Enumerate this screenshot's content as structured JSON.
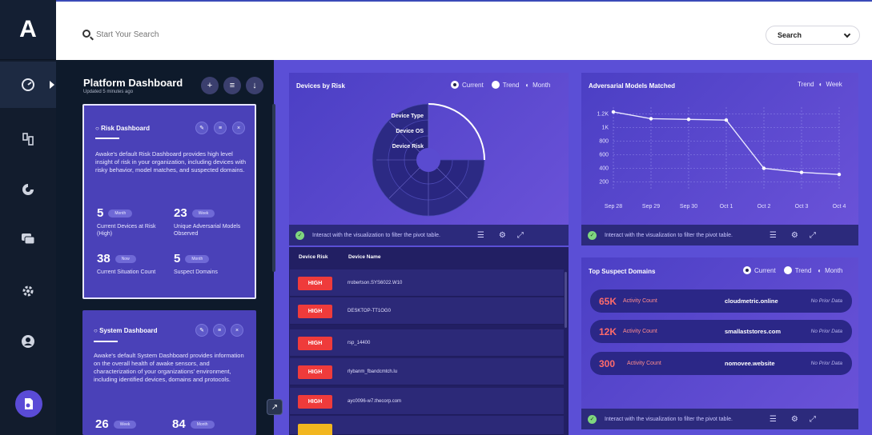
{
  "app": {
    "logo": "A"
  },
  "topbar": {
    "search_placeholder": "Start Your Search",
    "search_scope": "Search"
  },
  "rail": {
    "icons": [
      "dashboard-icon",
      "devices-icon",
      "models-icon",
      "chat-icon",
      "settings-icon",
      "user-icon",
      "report-icon"
    ]
  },
  "sidebar": {
    "title": "Platform Dashboard",
    "subtitle": "Updated 5 minutes ago",
    "cards": [
      {
        "title": "Risk Dashboard",
        "description": "Awake's default Risk Dashboard provides high level insight of risk in your organization, including devices with risky behavior, model matches, and suspected domains.",
        "stats": [
          {
            "value": "5",
            "period": "Month",
            "label": "Current Devices at Risk (High)"
          },
          {
            "value": "23",
            "period": "Week",
            "label": "Unique Adversarial Models Observed"
          },
          {
            "value": "38",
            "period": "Now",
            "label": "Current Situation Count"
          },
          {
            "value": "5",
            "period": "Month",
            "label": "Suspect Domains"
          }
        ]
      },
      {
        "title": "System Dashboard",
        "description": "Awake's default System Dashboard provides information on the overall health of awake sensors, and characterization of your organizations' environment, including identified devices, domains and protocols.",
        "stats": [
          {
            "value": "26",
            "period": "Week"
          },
          {
            "value": "84",
            "period": "Month"
          }
        ]
      }
    ]
  },
  "devices_by_risk": {
    "title": "Devices by Risk",
    "toggle_current": "Current",
    "toggle_trend": "Trend",
    "toggle_period": "Month",
    "rings": [
      "Device Type",
      "Device OS",
      "Device Risk"
    ],
    "footer": "Interact with the visualization to filter the pivot table."
  },
  "table": {
    "headers": [
      "Device Risk",
      "Device Name"
    ],
    "rows": [
      {
        "risk": "HIGH",
        "name": "rrobertson.SYS6022.W10"
      },
      {
        "risk": "HIGH",
        "name": "DESKTOP-TT1OG0"
      },
      {
        "risk": "HIGH",
        "name": "rsp_14400"
      },
      {
        "risk": "HIGH",
        "name": "rlybanm_fbandcmtch.lu"
      },
      {
        "risk": "HIGH",
        "name": "ayc0096-w7.thecorp.com"
      }
    ],
    "colors": {
      "high": "#ef3b3b",
      "medium": "#f2b61f"
    }
  },
  "adversarial": {
    "title": "Adversarial Models Matched",
    "toggle_trend": "Trend",
    "toggle_period": "Week",
    "footer": "Interact with the visualization to filter the pivot table."
  },
  "chart_data": {
    "type": "line",
    "title": "Adversarial Models Matched",
    "x": [
      "Sep 28",
      "Sep 29",
      "Sep 30",
      "Oct 1",
      "Oct 2",
      "Oct 3",
      "Oct 4"
    ],
    "y_ticks": [
      "1.2K",
      "1K",
      "800",
      "600",
      "400",
      "200"
    ],
    "ylim": [
      100,
      1300
    ],
    "series": [
      {
        "values": [
          1230,
          1130,
          1120,
          1110,
          400,
          340,
          310
        ]
      }
    ],
    "grid": true
  },
  "domains": {
    "title": "Top Suspect Domains",
    "toggle_current": "Current",
    "toggle_trend": "Trend",
    "toggle_period": "Month",
    "items": [
      {
        "count": "65K",
        "label": "Activity Count",
        "domain": "cloudmetric.online",
        "prior": "No Prior Data"
      },
      {
        "count": "12K",
        "label": "Activity Count",
        "domain": "smallaststores.com",
        "prior": "No Prior Data"
      },
      {
        "count": "300",
        "label": "Activity Count",
        "domain": "nomovee.website",
        "prior": "No Prior Data"
      }
    ],
    "footer": "Interact with the visualization to filter the pivot table."
  }
}
